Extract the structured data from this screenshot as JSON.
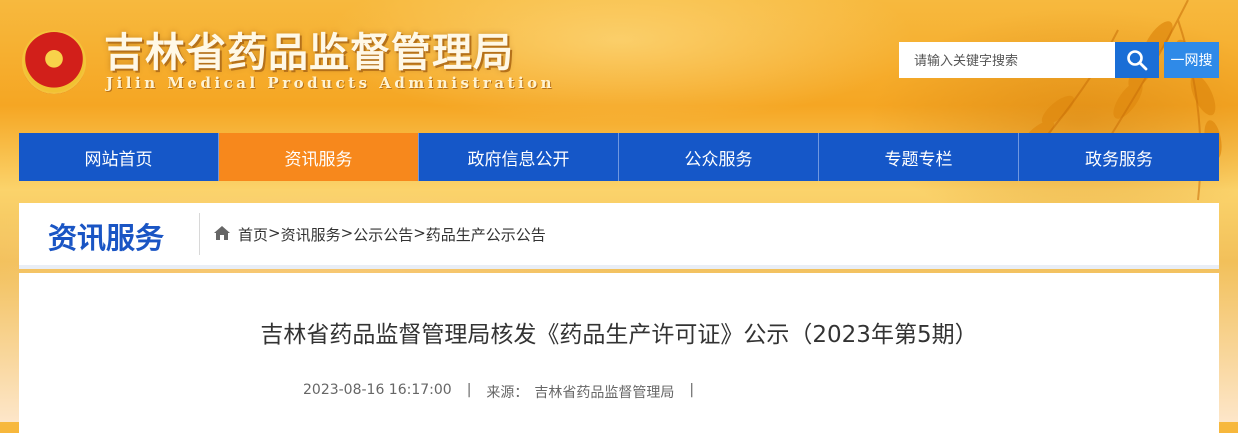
{
  "header": {
    "site_title": "吉林省药品监督管理局",
    "site_subtitle": "Jilin Medical Products Administration",
    "search_placeholder": "请输入关键字搜索",
    "yiwang_label": "一网搜"
  },
  "nav": {
    "items": [
      {
        "label": "网站首页"
      },
      {
        "label": "资讯服务"
      },
      {
        "label": "政府信息公开"
      },
      {
        "label": "公众服务"
      },
      {
        "label": "专题专栏"
      },
      {
        "label": "政务服务"
      }
    ],
    "active_index": 1
  },
  "crumb_bar": {
    "section_title": "资讯服务",
    "breadcrumb": [
      "首页",
      "资讯服务",
      "公示公告",
      "药品生产公示公告"
    ],
    "separator": ">"
  },
  "article": {
    "title": "吉林省药品监督管理局核发《药品生产许可证》公示（2023年第5期）",
    "datetime": "2023-08-16 16:17:00",
    "source_label": "来源：",
    "source": "吉林省药品监督管理局",
    "divider": "|"
  },
  "colors": {
    "nav_blue": "#1557c8",
    "nav_active_orange": "#f7881c",
    "section_title_blue": "#1a55c4",
    "search_button_blue": "#1a6ed6"
  },
  "icons": {
    "emblem": "national-emblem-icon",
    "search": "search-icon",
    "home": "home-icon"
  }
}
